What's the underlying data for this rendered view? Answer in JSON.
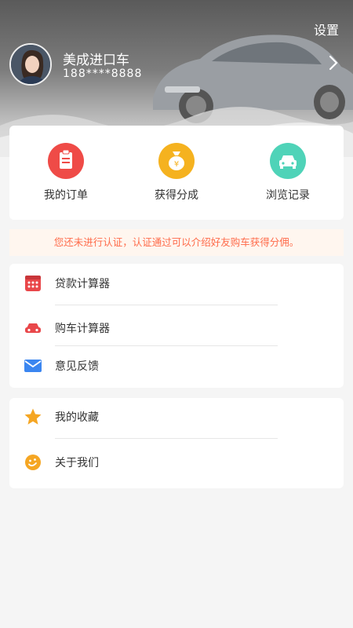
{
  "header": {
    "settings_label": "设置",
    "user_name": "美成进口车",
    "user_phone": "188****8888"
  },
  "quick_actions": [
    {
      "label": "我的订单",
      "icon": "clipboard-icon",
      "color": "#ef4b47"
    },
    {
      "label": "获得分成",
      "icon": "money-bag-icon",
      "color": "#f5b21f"
    },
    {
      "label": "浏览记录",
      "icon": "car-icon",
      "color": "#4fd3b8"
    }
  ],
  "notice": "您还未进行认证，认证通过可以介绍好友购车获得分佣。",
  "menu_group_1": [
    {
      "label": "贷款计算器",
      "icon": "calculator-icon",
      "color": "#e9474a"
    },
    {
      "label": "购车计算器",
      "icon": "car-icon",
      "color": "#e9474a"
    },
    {
      "label": "意见反馈",
      "icon": "mail-icon",
      "color": "#3b86f0"
    }
  ],
  "menu_group_2": [
    {
      "label": "我的收藏",
      "icon": "star-icon",
      "color": "#f5a623"
    },
    {
      "label": "关于我们",
      "icon": "smile-icon",
      "color": "#f5a623"
    }
  ]
}
